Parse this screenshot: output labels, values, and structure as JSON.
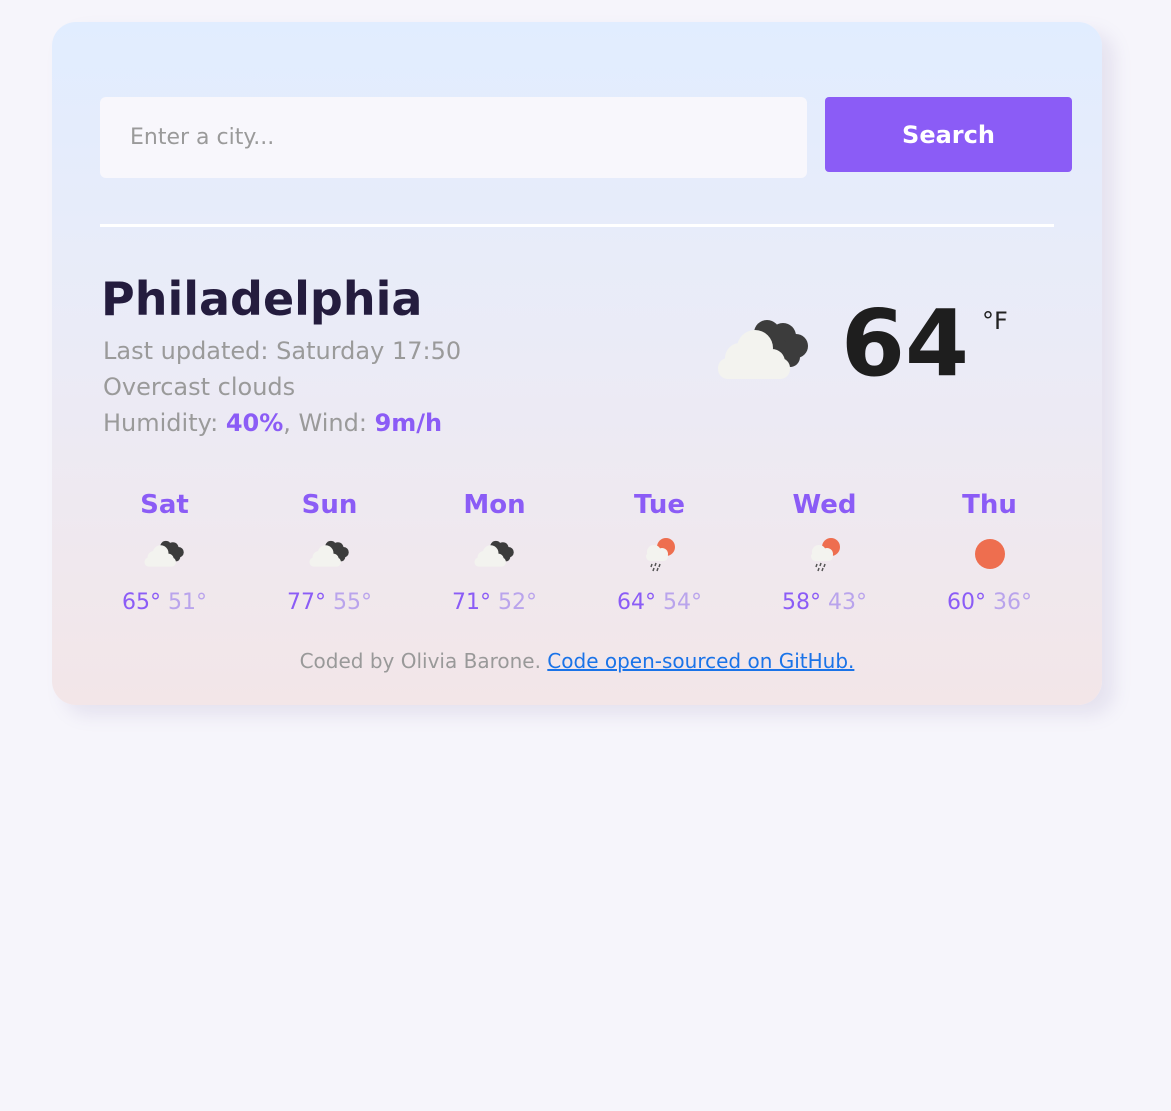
{
  "search": {
    "placeholder": "Enter a city...",
    "value": "",
    "button_label": "Search"
  },
  "current": {
    "city": "Philadelphia",
    "last_updated_label": "Last updated:",
    "last_updated_value": "Saturday 17:50",
    "description": "Overcast clouds",
    "humidity_label": "Humidity:",
    "humidity_value": "40%",
    "wind_label": "Wind:",
    "wind_value": "9m/h",
    "temperature": "64",
    "unit": "°F",
    "icon": "overcast-clouds-icon"
  },
  "forecast": [
    {
      "day": "Sat",
      "max": "65°",
      "min": "51°",
      "icon": "overcast-clouds-icon"
    },
    {
      "day": "Sun",
      "max": "77°",
      "min": "55°",
      "icon": "overcast-clouds-icon"
    },
    {
      "day": "Mon",
      "max": "71°",
      "min": "52°",
      "icon": "overcast-clouds-icon"
    },
    {
      "day": "Tue",
      "max": "64°",
      "min": "54°",
      "icon": "rain-sun-icon"
    },
    {
      "day": "Wed",
      "max": "58°",
      "min": "43°",
      "icon": "rain-sun-icon"
    },
    {
      "day": "Thu",
      "max": "60°",
      "min": "36°",
      "icon": "sun-icon"
    }
  ],
  "footer": {
    "text": "Coded by Olivia Barone.",
    "link_text": "Code open-sourced on GitHub."
  },
  "colors": {
    "accent": "#8b5cf6",
    "accent_light": "#b9a4ec",
    "sun": "#ee6e4f",
    "link": "#1a73e8"
  }
}
